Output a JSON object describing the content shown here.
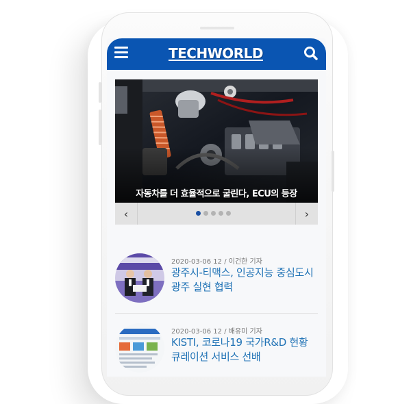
{
  "header": {
    "logo_text": "TECHWORLD",
    "menu_icon": "hamburger-menu-icon",
    "search_icon": "search-icon",
    "background_color": "#0a55b2"
  },
  "slider": {
    "caption": "자동차를 더 효율적으로 굴린다, ECU의 등장",
    "prev_symbol": "‹",
    "next_symbol": "›",
    "slide_count": 5,
    "active_index": 0
  },
  "news": [
    {
      "meta": "2020-03-06 12 / 이건한 기자",
      "title": "광주시-티맥스, 인공지능 중심도시 광주 실현 협력"
    },
    {
      "meta": "2020-03-06 12 / 배유미 기자",
      "title": "KISTI, 코로나19 국가R&D 현황 큐레이션 서비스 선배"
    }
  ]
}
